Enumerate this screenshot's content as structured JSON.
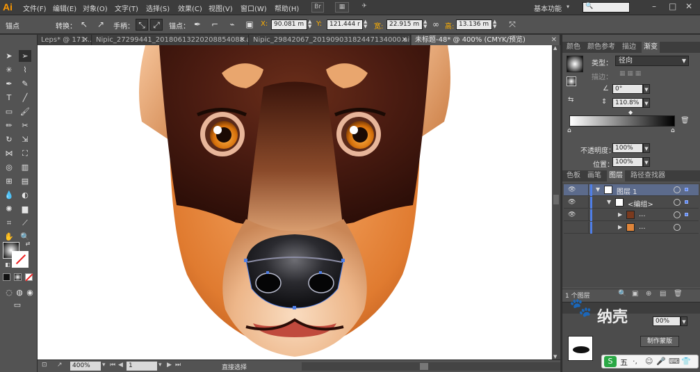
{
  "app": {
    "logo": "Ai"
  },
  "menu": [
    "文件(F)",
    "编辑(E)",
    "对象(O)",
    "文字(T)",
    "选择(S)",
    "效果(C)",
    "视图(V)",
    "窗口(W)",
    "帮助(H)"
  ],
  "workspace": "基本功能",
  "control": {
    "anchor_label": "锚点",
    "convert_label": "转换：",
    "handle_label": "手柄：",
    "anchor_label2": "锚点：",
    "x_label": "X:",
    "x_value": "90.081 m",
    "y_label": "Y:",
    "y_value": "121.444 r",
    "w_label": "宽:",
    "w_value": "22.915 m",
    "h_label": "高:",
    "h_value": "13.136 m"
  },
  "tabs": [
    {
      "label": "Leps* @ 171...",
      "active": false
    },
    {
      "label": "Nipic_27299441_20180613220208854088.ai*",
      "active": false
    },
    {
      "label": "Nipic_29842067_20190903182447134000.ai*",
      "active": false
    },
    {
      "label": "未标题-48* @ 400% (CMYK/预览)",
      "active": true
    }
  ],
  "status": {
    "zoom": "400%",
    "page": "1",
    "tool": "直接选择"
  },
  "gradient_panel": {
    "tabs": [
      "颜色",
      "颜色参考",
      "描边",
      "渐变"
    ],
    "active_tab": "渐变",
    "type_label": "类型：",
    "type_value": "径向",
    "stroke_label": "描边：",
    "angle_value": "0°",
    "ratio_value": "110.8%",
    "opacity_label": "不透明度：",
    "opacity_value": "100%",
    "position_label": "位置：",
    "position_value": "100%"
  },
  "layers_panel": {
    "tabs": [
      "色板",
      "画笔",
      "图层",
      "路径查找器"
    ],
    "active_tab": "图层",
    "rows": [
      {
        "name": "图层 1"
      },
      {
        "name": "<编组>"
      },
      {
        "name": "..."
      },
      {
        "name": "..."
      }
    ],
    "footer": "1 个图层"
  },
  "bottom_panel": {
    "opacity_value": "00%",
    "button_label": "制作蒙版"
  },
  "watermark": {
    "text": "纳壳"
  },
  "colors": {
    "accent": "#4f7fe8",
    "nose_dark": "#1b1b1f",
    "fur_dark": "#4a1c12",
    "fur_mid": "#7a3a1e",
    "fur_orange": "#e0853a",
    "muzzle": "#f2c8a2",
    "eye": "#d87a10"
  }
}
